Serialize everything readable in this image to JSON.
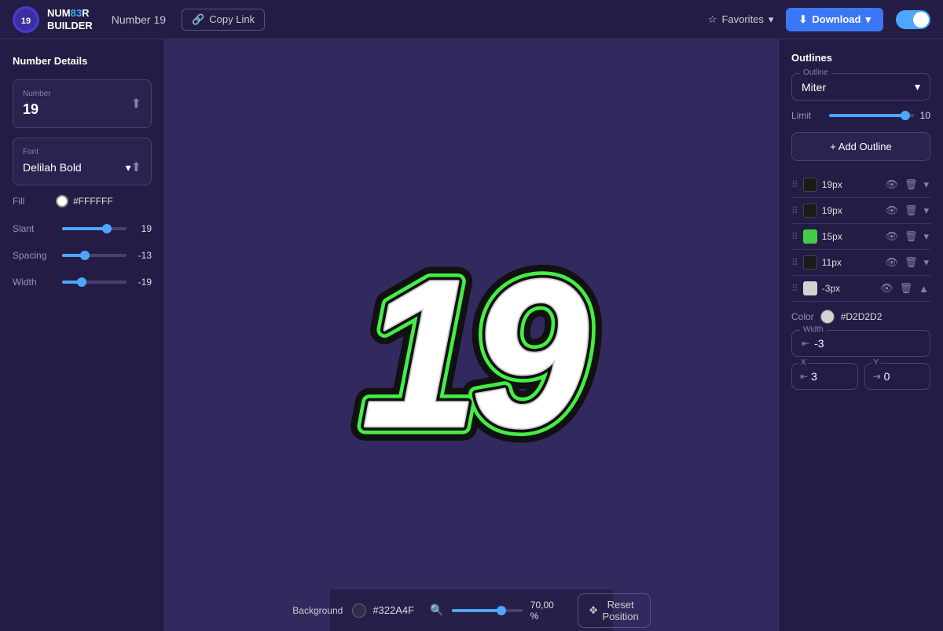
{
  "header": {
    "logo_line1": "NUM83R",
    "logo_line2": "BUILDER",
    "page_title": "Number 19",
    "copy_link_label": "Copy Link",
    "favorites_label": "Favorites",
    "download_label": "Download"
  },
  "left_panel": {
    "title": "Number Details",
    "number_label": "Number",
    "number_value": "19",
    "font_label": "Font",
    "font_value": "Delilah Bold",
    "fill_label": "Fill",
    "fill_color": "#FFFFFF",
    "fill_color_display": "#FFFFFF",
    "slant_label": "Slant",
    "slant_value": "19",
    "slant_percent": 70,
    "spacing_label": "Spacing",
    "spacing_value": "-13",
    "spacing_percent": 35,
    "width_label": "Width",
    "width_value": "-19",
    "width_percent": 30
  },
  "right_panel": {
    "title": "Outlines",
    "outline_type_label": "Outline",
    "outline_type_value": "Miter",
    "limit_label": "Limit",
    "limit_value": "10",
    "limit_percent": 90,
    "add_outline_label": "+ Add Outline",
    "outlines": [
      {
        "id": 1,
        "color": "#1a1a1a",
        "px": "19px",
        "visible": true
      },
      {
        "id": 2,
        "color": "#1a1a1a",
        "px": "19px",
        "visible": true
      },
      {
        "id": 3,
        "color": "#44cc44",
        "px": "15px",
        "visible": true
      },
      {
        "id": 4,
        "color": "#1a1a1a",
        "px": "11px",
        "visible": true
      },
      {
        "id": 5,
        "color": "#d2d2d2",
        "px": "-3px",
        "visible": true,
        "expanded": true
      }
    ],
    "selected_outline": {
      "color_label": "Color",
      "color": "#D2D2D2",
      "color_hex": "#D2D2D2",
      "width_label": "Width",
      "width_value": "-3",
      "x_label": "X",
      "x_value": "3",
      "y_label": "Y",
      "y_value": "0"
    }
  },
  "bottom_bar": {
    "background_label": "Background",
    "background_color": "#322A4F",
    "background_hex": "#322A4F",
    "zoom_value": "70,00 %",
    "zoom_percent": 70,
    "reset_label": "Reset Position"
  },
  "canvas": {
    "background": "#322A5E"
  }
}
